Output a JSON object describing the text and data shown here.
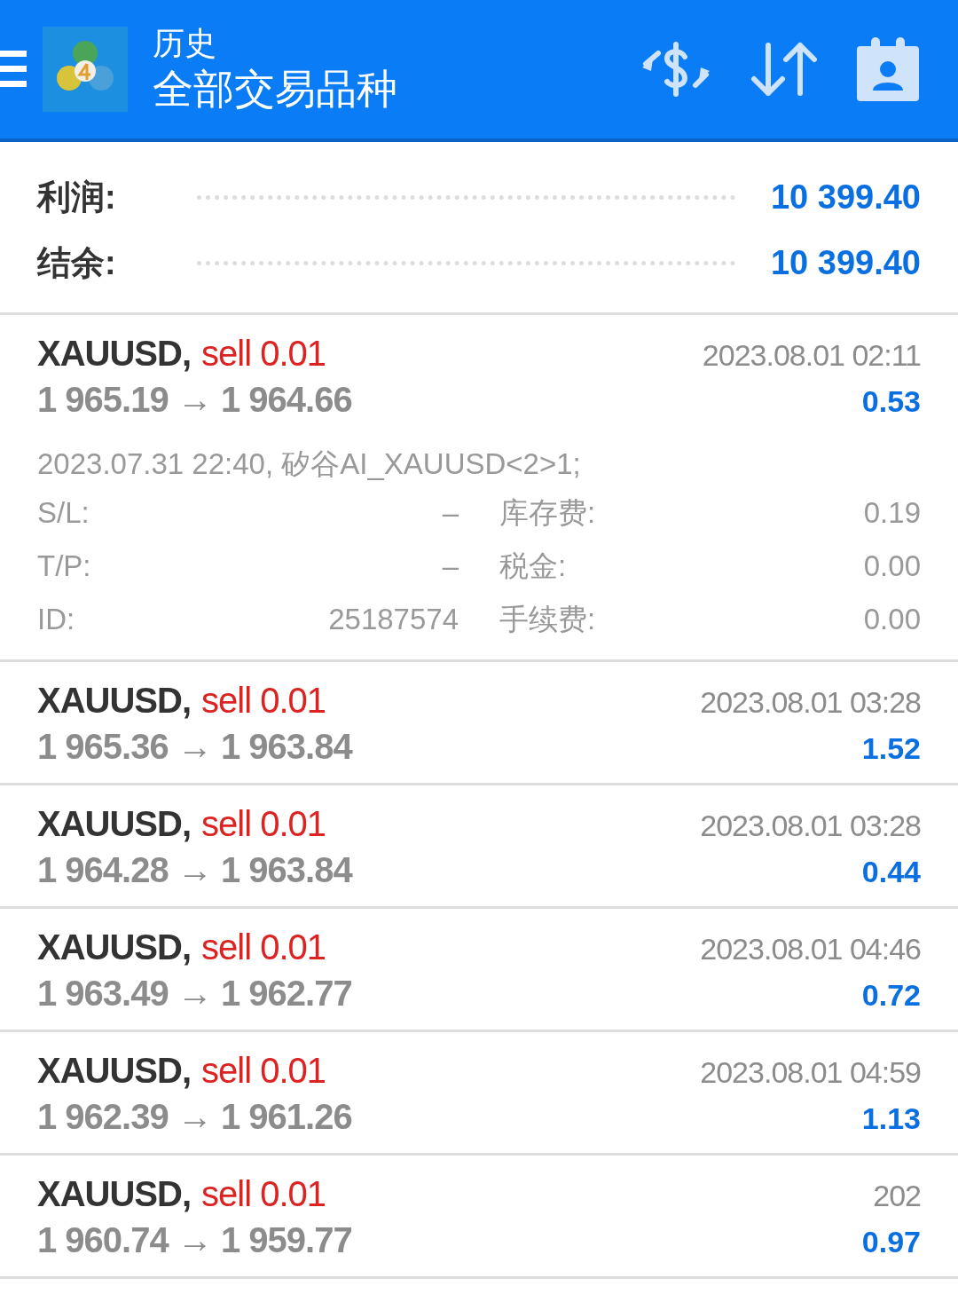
{
  "header": {
    "title": "历史",
    "subtitle": "全部交易品种"
  },
  "summary": [
    {
      "label": "利润:",
      "value": "10 399.40"
    },
    {
      "label": "结余:",
      "value": "10 399.40"
    }
  ],
  "trades": [
    {
      "symbol": "XAUUSD,",
      "side": "sell 0.01",
      "prices": "1 965.19 → 1 964.66",
      "time": "2023.08.01 02:11",
      "profit": "0.53",
      "comment": "2023.07.31 22:40, 矽谷AI_XAUUSD<2>1;",
      "fields": [
        [
          "S/L:",
          "–",
          "库存费:",
          "0.19"
        ],
        [
          "T/P:",
          "–",
          "税金:",
          "0.00"
        ],
        [
          "ID:",
          "25187574",
          "手续费:",
          "0.00"
        ]
      ]
    },
    {
      "symbol": "XAUUSD,",
      "side": "sell 0.01",
      "prices": "1 965.36 → 1 963.84",
      "time": "2023.08.01 03:28",
      "profit": "1.52"
    },
    {
      "symbol": "XAUUSD,",
      "side": "sell 0.01",
      "prices": "1 964.28 → 1 963.84",
      "time": "2023.08.01 03:28",
      "profit": "0.44"
    },
    {
      "symbol": "XAUUSD,",
      "side": "sell 0.01",
      "prices": "1 963.49 → 1 962.77",
      "time": "2023.08.01 04:46",
      "profit": "0.72"
    },
    {
      "symbol": "XAUUSD,",
      "side": "sell 0.01",
      "prices": "1 962.39 → 1 961.26",
      "time": "2023.08.01 04:59",
      "profit": "1.13"
    },
    {
      "symbol": "XAUUSD,",
      "side": "sell 0.01",
      "prices": "1 960.74 → 1 959.77",
      "time": "202",
      "profit": "0.97"
    }
  ]
}
